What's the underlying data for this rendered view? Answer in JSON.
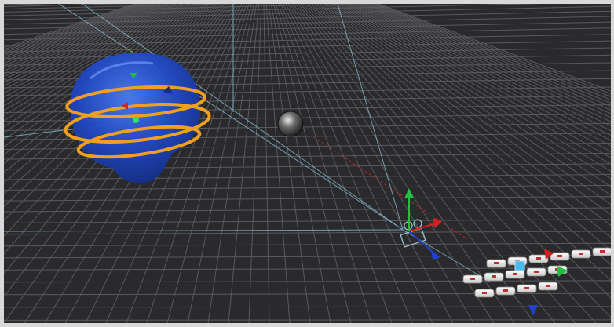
{
  "viewport": {
    "background": "#2a2a2c",
    "grid_color": "#5a5a5e",
    "camera_lines_color": "#7fb3c8"
  },
  "scene_objects": [
    {
      "name": "head-mesh",
      "color": "#2a55d0",
      "selected": true
    },
    {
      "name": "chrome-sphere",
      "color": "#9a9a9a",
      "selected": false
    },
    {
      "name": "camera-node",
      "color": "#a0c8d8",
      "selected": false
    },
    {
      "name": "keyboard-mesh",
      "color": "#e8e8e8",
      "selected": false
    }
  ],
  "gizmos": {
    "rotate": {
      "target": "head-mesh",
      "ring_color": "#f0a020"
    },
    "translate": {
      "target": "camera-node",
      "x_color": "#d02020",
      "y_color": "#20c040",
      "z_color": "#2040d0"
    }
  },
  "icons": [
    "rotate-gizmo-icon",
    "translate-gizmo-icon",
    "camera-icon"
  ]
}
